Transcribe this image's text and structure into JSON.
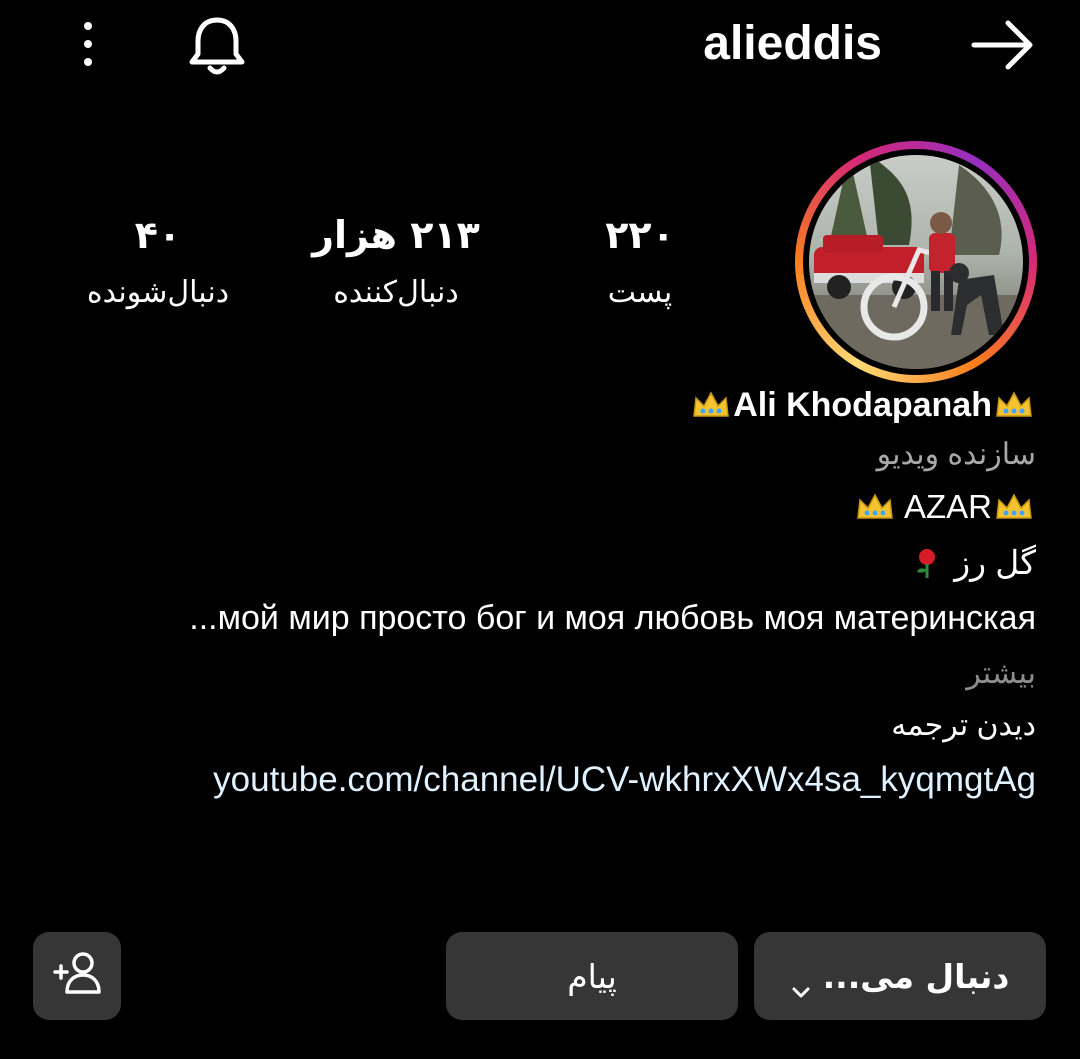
{
  "header": {
    "username": "alieddis",
    "icons": [
      "more-vertical-icon",
      "bell-icon",
      "arrow-right-icon"
    ]
  },
  "stats": {
    "posts": {
      "value": "۲۲۰",
      "label": "پست"
    },
    "followers": {
      "value": "۲۱۳ هزار",
      "label": "دنبال‌کننده"
    },
    "following": {
      "value": "۴۰",
      "label": "دنبال‌شونده"
    }
  },
  "bio": {
    "display_name": "Ali Khodapanah",
    "category": "سازنده ویدیو",
    "line1": "AZAR",
    "line2_text": "گل رز",
    "line3": "...мой мир просто бог и моя любовь моя материнская",
    "more": "بیشتر",
    "see_translation": "دیدن ترجمه",
    "link": "youtube.com/channel/UCV-wkhrxXWx4sa_kyqmgtAg"
  },
  "actions": {
    "follow_label": "دنبال می...",
    "message_label": "پیام"
  },
  "colors": {
    "background": "#000000",
    "button_bg": "#363636",
    "muted_text": "#a8a8a8",
    "link_text": "#e0f1ff"
  }
}
